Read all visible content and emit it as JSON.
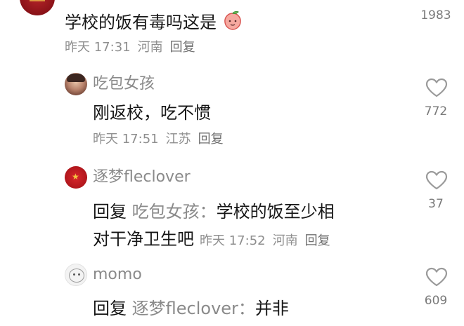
{
  "comment_top": {
    "text": "学校的饭有毒吗这是",
    "emoji": "peach-face-emoji",
    "time": "昨天 17:31",
    "location": "河南",
    "reply_label": "回复",
    "likes": "1983"
  },
  "reply_1": {
    "username": "吃包女孩",
    "text": "刚返校，吃不惯",
    "time": "昨天 17:51",
    "location": "江苏",
    "reply_label": "回复",
    "likes": "772"
  },
  "reply_2": {
    "username": "逐梦fleclover",
    "reply_prefix": "回复",
    "mention": "吃包女孩：",
    "text_line1": "学校的饭至少相",
    "text_line2": "对干净卫生吧",
    "time": "昨天 17:52",
    "location": "河南",
    "reply_label": "回复",
    "likes": "37"
  },
  "reply_3": {
    "username": "momo",
    "reply_prefix": "回复",
    "mention": "逐梦fleclover：",
    "text": "并非",
    "likes": "609"
  },
  "icons": {
    "like": "heart-outline-icon"
  },
  "colors": {
    "text": "#161616",
    "meta": "#8e8e8e",
    "heart_stroke": "#9a9a9a"
  }
}
